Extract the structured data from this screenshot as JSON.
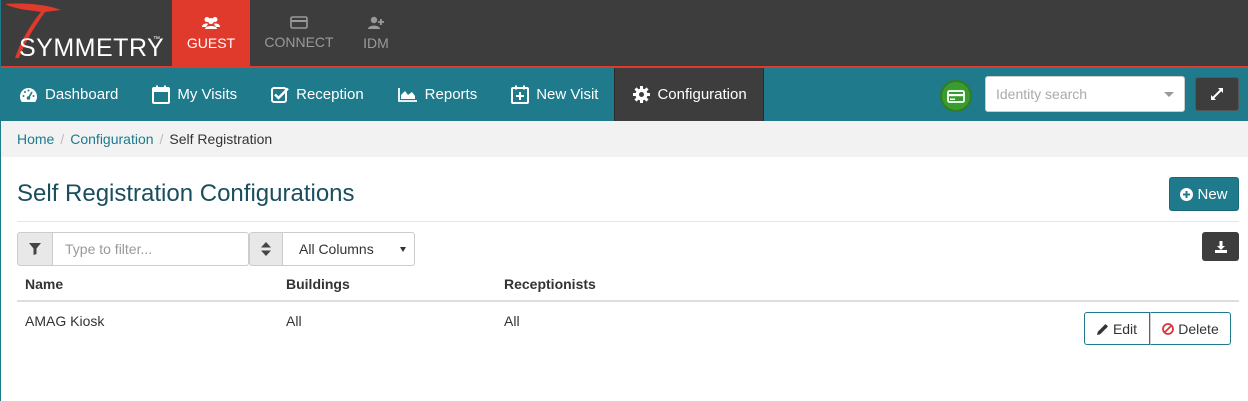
{
  "brand": {
    "logo_text": "SYMMETRY",
    "trademark": "™"
  },
  "apps": [
    {
      "label": "GUEST",
      "icon": "users-icon",
      "active": true
    },
    {
      "label": "CONNECT",
      "icon": "card-icon",
      "active": false
    },
    {
      "label": "IDM",
      "icon": "add-user-icon",
      "active": false
    }
  ],
  "nav": {
    "items": [
      {
        "label": "Dashboard",
        "icon": "dashboard-icon"
      },
      {
        "label": "My Visits",
        "icon": "calendar-icon"
      },
      {
        "label": "Reception",
        "icon": "check-square-icon"
      },
      {
        "label": "Reports",
        "icon": "area-chart-icon"
      },
      {
        "label": "New Visit",
        "icon": "calendar-plus-icon"
      },
      {
        "label": "Configuration",
        "icon": "gear-icon",
        "active": true
      }
    ],
    "search_placeholder": "Identity search"
  },
  "breadcrumb": {
    "home": "Home",
    "section": "Configuration",
    "current": "Self Registration"
  },
  "main": {
    "title": "Self Registration Configurations",
    "new_label": "New",
    "filter_placeholder": "Type to filter...",
    "columns_selected": "All Columns"
  },
  "table": {
    "headers": [
      "Name",
      "Buildings",
      "Receptionists"
    ],
    "rows": [
      {
        "name": "AMAG Kiosk",
        "buildings": "All",
        "receptionists": "All",
        "edit_label": "Edit",
        "delete_label": "Delete"
      }
    ]
  },
  "colors": {
    "accent": "#1f7a8c",
    "active_app": "#e03a2c",
    "topbar": "#3d3d3d",
    "card_button": "#3a9b2e",
    "delete_icon": "#d9363e"
  }
}
